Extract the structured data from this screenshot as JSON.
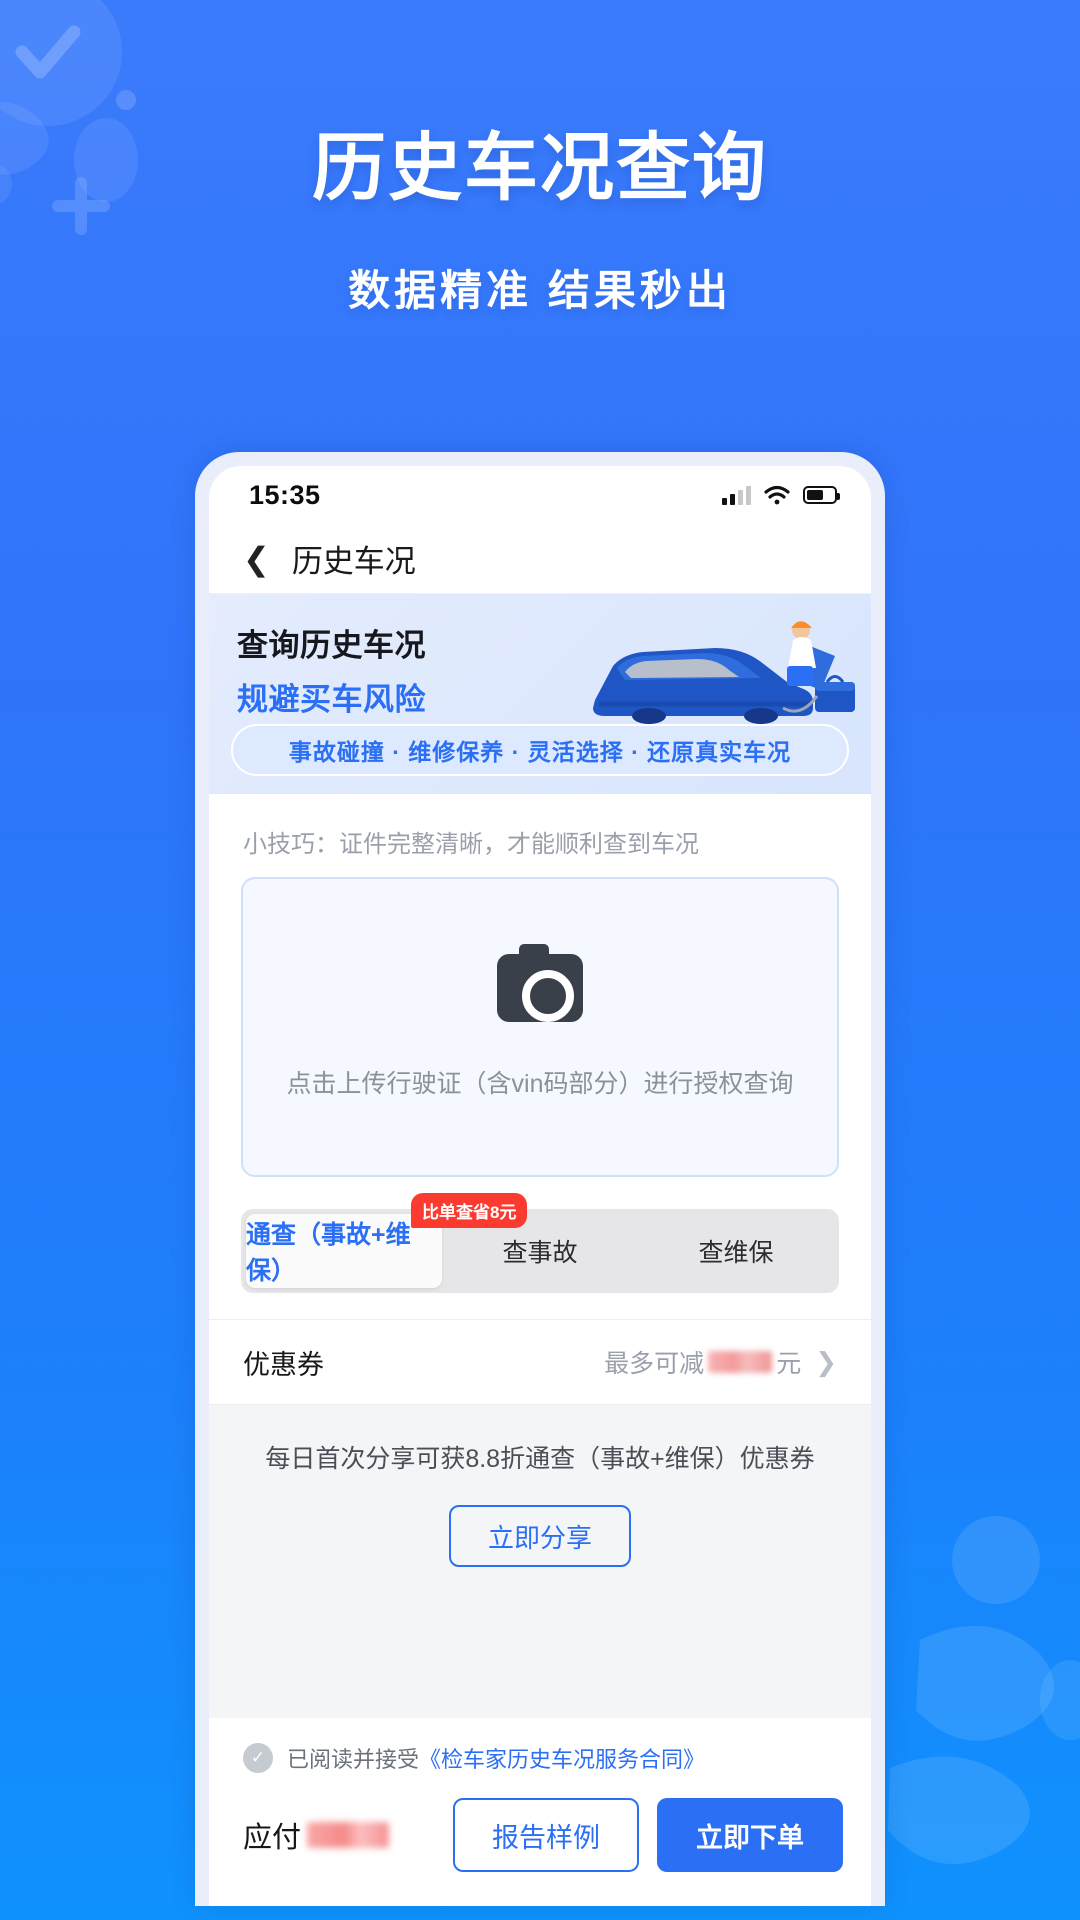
{
  "hero": {
    "title": "历史车况查询",
    "subtitle": "数据精准 结果秒出"
  },
  "statusbar": {
    "time": "15:35",
    "signal_icon": "signal-bars-icon",
    "wifi_icon": "wifi-icon",
    "battery_icon": "battery-icon"
  },
  "navbar": {
    "back_icon": "chevron-left-icon",
    "title": "历史车况"
  },
  "banner": {
    "headline": "查询历史车况",
    "subhead": "规避买车风险",
    "pill": "事故碰撞 · 维修保养 · 灵活选择 · 还原真实车况",
    "art_icon": "car-inspection-illustration"
  },
  "upload": {
    "tip": "小技巧：证件完整清晰，才能顺利查到车况",
    "camera_icon": "camera-icon",
    "hint": "点击上传行驶证（含vin码部分）进行授权查询"
  },
  "tabs": {
    "badge": "比单查省8元",
    "items": [
      {
        "label": "通查（事故+维保）",
        "active": true
      },
      {
        "label": "查事故",
        "active": false
      },
      {
        "label": "查维保",
        "active": false
      }
    ]
  },
  "coupon": {
    "label": "优惠券",
    "value_prefix": "最多可减",
    "value_suffix": "元",
    "value_masked": true,
    "chevron_icon": "chevron-right-icon"
  },
  "share": {
    "text": "每日首次分享可获8.8折通查（事故+维保）优惠券",
    "button": "立即分享"
  },
  "agreement": {
    "checkbox_icon": "check-circle-icon",
    "checked": true,
    "text": "已阅读并接受",
    "link": "《检车家历史车况服务合同》"
  },
  "footer": {
    "pay_label": "应付",
    "pay_masked": true,
    "sample_button": "报告样例",
    "order_button": "立即下单"
  },
  "colors": {
    "brand_blue": "#2b6ff5",
    "page_blue": "#2f74fb",
    "badge_red": "#fc3b30"
  }
}
